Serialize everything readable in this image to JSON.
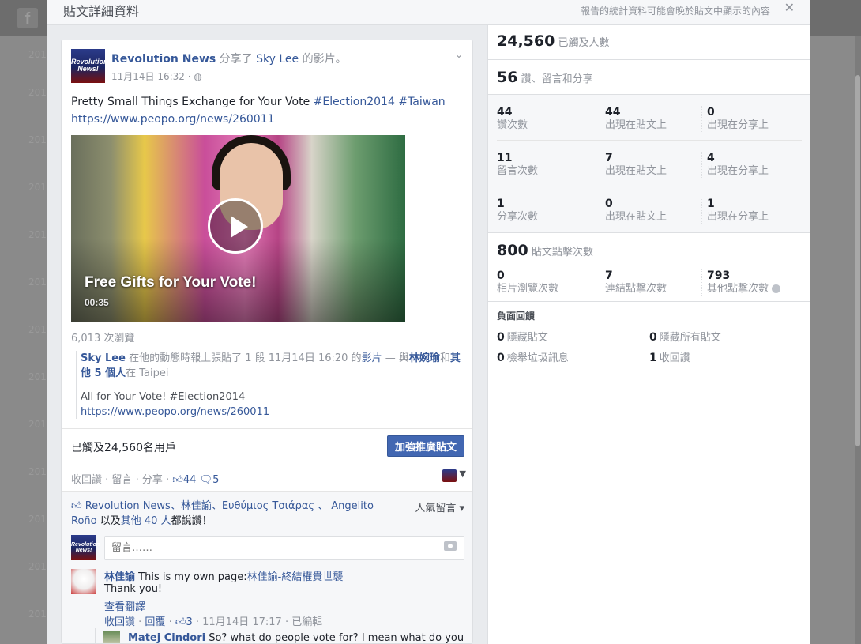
{
  "background": {
    "logo": "f",
    "years": [
      "201",
      "201",
      "201",
      "201",
      "201",
      "201",
      "201",
      "201",
      "201",
      "201",
      "201",
      "201",
      "201"
    ]
  },
  "dialog": {
    "title": "貼文詳細資料",
    "note": "報告的統計資料可能會晚於貼文中顯示的內容",
    "close_icon": "✕"
  },
  "post": {
    "avatar_text": "Revolution News!",
    "author": "Revolution News",
    "shared_prefix": "分享了",
    "shared_user": "Sky Lee",
    "shared_suffix": "的影片。",
    "time": "11月14日 16:32 · ",
    "globe_icon": "◍",
    "text_main": "Pretty Small Things Exchange for Your Vote ",
    "hashtag1": "#Election2014",
    "hashtag2": "#Taiwan",
    "link": "https://www.peopo.org/news/260011",
    "video": {
      "caption": "Free Gifts for Your Vote!",
      "duration": "00:35"
    },
    "views": "6,013 次瀏覽",
    "original": {
      "user": "Sky Lee",
      "meta_part1": " 在他的動態時報上張貼了 1 段 11月14日 16:20 的",
      "video_word": "影片",
      "meta_part2": " — 與",
      "tagged1": "林婉瑜",
      "and_word": "和",
      "others": "其他 5 個人",
      "at_word": "在 Taipei",
      "text": "All for Your Vote! #Election2014",
      "link": "https://www.peopo.org/news/260011"
    },
    "reach_text": "已觸及24,560名用戶",
    "boost_button": "加強推廣貼文",
    "actions": {
      "retract": "收回讚",
      "comment": "留言",
      "share": "分享",
      "like_count": "44",
      "comment_count": "5"
    },
    "likes_line": {
      "names": "Revolution News、林佳諭、Ευθύμιος Τσιάρας 、 Angelito Roño",
      "suffix_pre": " 以及",
      "others": "其他 40 人",
      "suffix_post": "都說讚！"
    },
    "sort_label": "人氣留言 ▾",
    "comment_placeholder": "留言……",
    "comments": [
      {
        "name": "林佳諭",
        "text_prefix": " This is my own page:",
        "page_link": "林佳諭-終結權貴世襲",
        "line2": "Thank you!",
        "translate": "查看翻譯",
        "actions": {
          "retract": "收回讚",
          "reply": "回覆",
          "likes": "3",
          "time": "11月14日 17:17",
          "edited": "已編輯"
        }
      },
      {
        "name": "Matej Cindori",
        "text": " So? what do people vote for? I mean what do you"
      }
    ]
  },
  "stats": {
    "reach": {
      "value": "24,560",
      "label": "已觸及人數"
    },
    "engagement": {
      "value": "56",
      "label": "讚、留言和分享"
    },
    "rows": [
      [
        {
          "num": "44",
          "lbl": "讚次數"
        },
        {
          "num": "44",
          "lbl": "出現在貼文上"
        },
        {
          "num": "0",
          "lbl": "出現在分享上"
        }
      ],
      [
        {
          "num": "11",
          "lbl": "留言次數"
        },
        {
          "num": "7",
          "lbl": "出現在貼文上"
        },
        {
          "num": "4",
          "lbl": "出現在分享上"
        }
      ],
      [
        {
          "num": "1",
          "lbl": "分享次數"
        },
        {
          "num": "0",
          "lbl": "出現在貼文上"
        },
        {
          "num": "1",
          "lbl": "出現在分享上"
        }
      ]
    ],
    "clicks": {
      "value": "800",
      "label": "貼文點擊次數",
      "items": [
        {
          "num": "0",
          "lbl": "相片瀏覽次數"
        },
        {
          "num": "7",
          "lbl": "連結點擊次數"
        },
        {
          "num": "793",
          "lbl": "其他點擊次數"
        }
      ],
      "info_icon": "i"
    },
    "negative": {
      "title": "負面回饋",
      "hide_post": {
        "num": "0",
        "lbl": "隱藏貼文"
      },
      "hide_all": {
        "num": "0",
        "lbl": "隱藏所有貼文"
      },
      "report_spam": {
        "num": "0",
        "lbl": "檢舉垃圾訊息"
      },
      "unlike": {
        "num": "1",
        "lbl": "收回讚"
      }
    }
  }
}
